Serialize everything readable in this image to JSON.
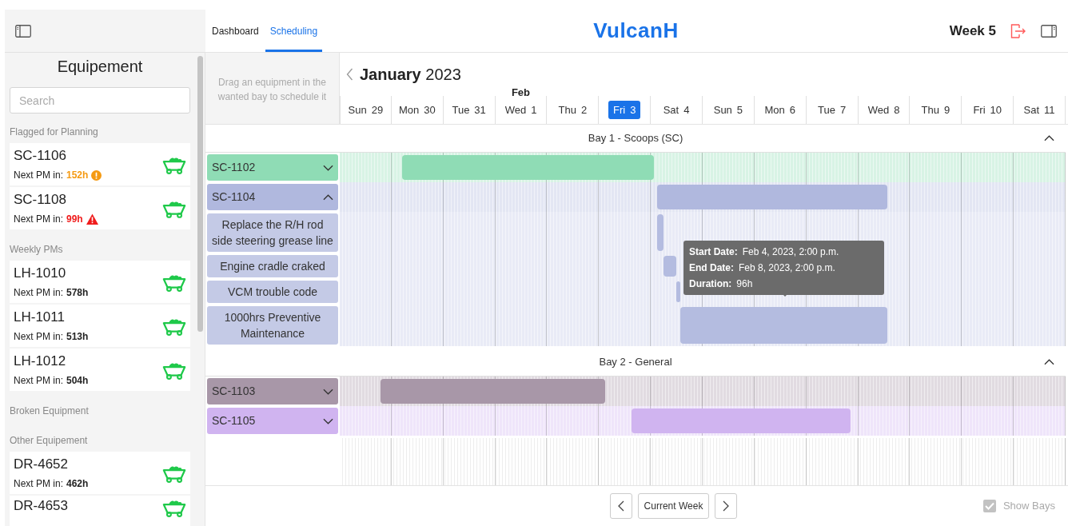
{
  "sidebar": {
    "title": "Equipement",
    "search": {
      "placeholder": "Search"
    },
    "sections": [
      {
        "heading": "Flagged for Planning",
        "items": [
          {
            "name": "SC-1106",
            "pm_label": "Next PM in:",
            "pm_value": "152h",
            "kind": "warning"
          },
          {
            "name": "SC-1108",
            "pm_label": "Next PM in:",
            "pm_value": "99h",
            "kind": "critical"
          }
        ]
      },
      {
        "heading": "Weekly PMs",
        "items": [
          {
            "name": "LH-1010",
            "pm_label": "Next PM in:",
            "pm_value": "578h",
            "kind": "normal"
          },
          {
            "name": "LH-1011",
            "pm_label": "Next PM in:",
            "pm_value": "513h",
            "kind": "normal"
          },
          {
            "name": "LH-1012",
            "pm_label": "Next PM in:",
            "pm_value": "504h",
            "kind": "normal"
          }
        ]
      },
      {
        "heading": "Broken Equipment"
      },
      {
        "heading": "Other Equipement",
        "items": [
          {
            "name": "DR-4652",
            "pm_label": "Next PM in:",
            "pm_value": "462h",
            "kind": "normal"
          },
          {
            "name": "DR-4653"
          }
        ]
      }
    ]
  },
  "header": {
    "tabs": [
      {
        "label": "Dashboard",
        "selected": false
      },
      {
        "label": "Scheduling",
        "selected": true
      }
    ],
    "logo": "VulcanH",
    "week": "Week 5"
  },
  "calendar": {
    "hint": "Drag an equipment in the wanted bay to schedule it",
    "month": "January",
    "year": "2023",
    "days": [
      {
        "weekday": "Sun",
        "day": "29",
        "selected": false
      },
      {
        "weekday": "Mon",
        "day": "30",
        "selected": false
      },
      {
        "weekday": "Tue",
        "day": "31",
        "selected": false
      },
      {
        "weekday": "Wed",
        "day": "1",
        "month_label": "Feb",
        "selected": false
      },
      {
        "weekday": "Thu",
        "day": "2",
        "selected": false
      },
      {
        "weekday": "Fri",
        "day": "3",
        "selected": true
      },
      {
        "weekday": "Sat",
        "day": "4",
        "selected": false
      },
      {
        "weekday": "Sun",
        "day": "5",
        "selected": false
      },
      {
        "weekday": "Mon",
        "day": "6",
        "selected": false
      },
      {
        "weekday": "Tue",
        "day": "7",
        "selected": false
      },
      {
        "weekday": "Wed",
        "day": "8",
        "selected": false
      },
      {
        "weekday": "Thu",
        "day": "9",
        "selected": false
      },
      {
        "weekday": "Fri",
        "day": "10",
        "selected": false
      },
      {
        "weekday": "Sat",
        "day": "11",
        "selected": false
      }
    ],
    "bays": [
      {
        "title": "Bay 1 - Scoops (SC)",
        "expanded": true,
        "rows": [
          {
            "label": "SC-1102",
            "color": "#8fdcb5",
            "expanded": false
          },
          {
            "label": "SC-1104",
            "color": "#b0b8de",
            "expanded": true,
            "children": [
              {
                "label": "Replace the R/H rod side steering grease line"
              },
              {
                "label": "Engine cradle craked"
              },
              {
                "label": "VCM trouble code"
              },
              {
                "label": "1000hrs Preventive Maintenance"
              }
            ]
          }
        ]
      },
      {
        "title": "Bay 2 - General",
        "expanded": true,
        "rows": [
          {
            "label": "SC-1103",
            "color": "#a897a8",
            "expanded": false
          },
          {
            "label": "SC-1105",
            "color": "#d0b4f0",
            "expanded": false
          }
        ]
      }
    ],
    "tooltip": {
      "lines": [
        {
          "label": "Start Date:",
          "value": "Feb 4, 2023, 2:00 p.m."
        },
        {
          "label": "End Date:",
          "value": "Feb 8, 2023, 2:00 p.m."
        },
        {
          "label": "Duration:",
          "value": "96h"
        }
      ]
    }
  },
  "footer": {
    "current_week": "Current Week",
    "show_bays": {
      "label": "Show Bays",
      "checked": true
    }
  }
}
